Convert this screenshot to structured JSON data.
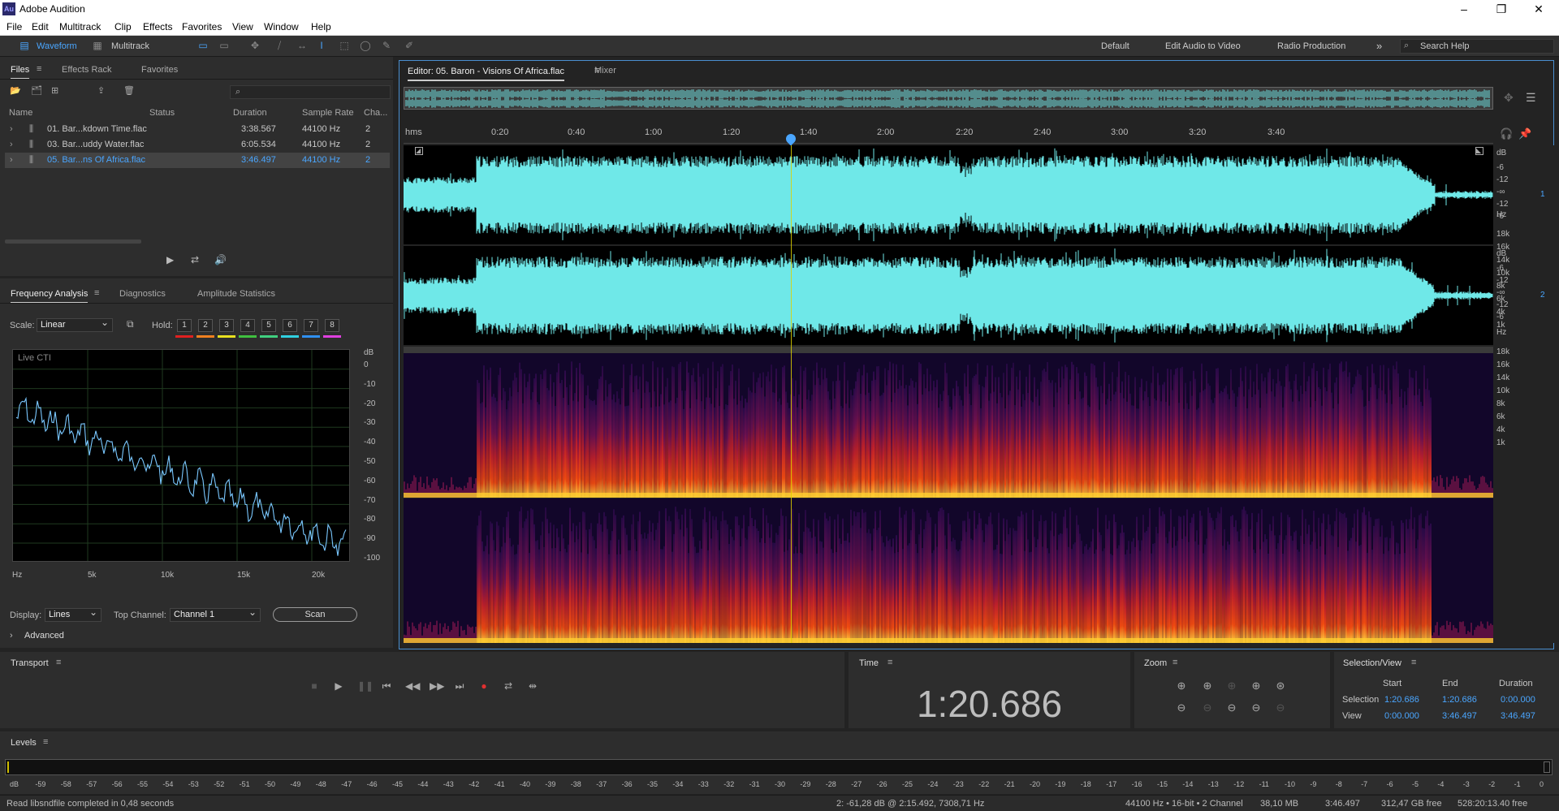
{
  "app": {
    "title": "Adobe Audition",
    "logo": "Au"
  },
  "menu": [
    "File",
    "Edit",
    "Multitrack",
    "Clip",
    "Effects",
    "Favorites",
    "View",
    "Window",
    "Help"
  ],
  "toolbar": {
    "waveform": "Waveform",
    "multitrack": "Multitrack",
    "workspaces": [
      "Default",
      "Edit Audio to Video",
      "Radio Production"
    ],
    "search_placeholder": "Search Help"
  },
  "files": {
    "tabs": [
      "Files",
      "Effects Rack",
      "Favorites"
    ],
    "columns": [
      "Name",
      "Status",
      "Duration",
      "Sample Rate",
      "Cha..."
    ],
    "rows": [
      {
        "name": "01. Bar...kdown Time.flac",
        "duration": "3:38.567",
        "rate": "44100 Hz",
        "ch": "2"
      },
      {
        "name": "03. Bar...uddy Water.flac",
        "duration": "6:05.534",
        "rate": "44100 Hz",
        "ch": "2"
      },
      {
        "name": "05. Bar...ns Of Africa.flac",
        "duration": "3:46.497",
        "rate": "44100 Hz",
        "ch": "2"
      }
    ]
  },
  "analysis": {
    "tabs": [
      "Frequency Analysis",
      "Diagnostics",
      "Amplitude Statistics"
    ],
    "scale_label": "Scale:",
    "scale_value": "Linear",
    "hold_label": "Hold:",
    "hold": [
      "1",
      "2",
      "3",
      "4",
      "5",
      "6",
      "7",
      "8"
    ],
    "hold_colors": [
      "#e02020",
      "#f08020",
      "#e8e020",
      "#40c040",
      "#40d080",
      "#30d0e0",
      "#3090f0",
      "#e040e0"
    ],
    "live": "Live CTI",
    "db_label": "dB",
    "db_ticks": [
      "0",
      "-10",
      "-20",
      "-30",
      "-40",
      "-50",
      "-60",
      "-70",
      "-80",
      "-90",
      "-100"
    ],
    "hz_ticks": [
      "Hz",
      "5k",
      "10k",
      "15k",
      "20k"
    ],
    "display_label": "Display:",
    "display_value": "Lines",
    "top_channel_label": "Top Channel:",
    "top_channel_value": "Channel 1",
    "scan": "Scan",
    "advanced": "Advanced"
  },
  "editor": {
    "tab": "Editor: 05. Baron - Visions Of Africa.flac",
    "mixer": "Mixer",
    "ruler": [
      "hms",
      "0:20",
      "0:40",
      "1:00",
      "1:20",
      "1:40",
      "2:00",
      "2:20",
      "2:40",
      "3:00",
      "3:20",
      "3:40"
    ],
    "db_ticks": [
      "dB",
      "-6",
      "-12",
      "-∞",
      "-12",
      "-6"
    ],
    "ch1": "1",
    "ch2": "2",
    "hz_ticks": [
      "Hz",
      "18k",
      "16k",
      "14k",
      "10k",
      "8k",
      "6k",
      "4k",
      "1k"
    ]
  },
  "transport": {
    "title": "Transport"
  },
  "time": {
    "title": "Time",
    "value": "1:20.686"
  },
  "zoom": {
    "title": "Zoom"
  },
  "selection": {
    "title": "Selection/View",
    "headers": [
      "Start",
      "End",
      "Duration"
    ],
    "rows": [
      {
        "label": "Selection",
        "start": "1:20.686",
        "end": "1:20.686",
        "dur": "0:00.000"
      },
      {
        "label": "View",
        "start": "0:00.000",
        "end": "3:46.497",
        "dur": "3:46.497"
      }
    ]
  },
  "levels": {
    "title": "Levels",
    "ticks": [
      "dB",
      "-59",
      "-58",
      "-57",
      "-56",
      "-55",
      "-54",
      "-53",
      "-52",
      "-51",
      "-50",
      "-49",
      "-48",
      "-47",
      "-46",
      "-45",
      "-44",
      "-43",
      "-42",
      "-41",
      "-40",
      "-39",
      "-38",
      "-37",
      "-36",
      "-35",
      "-34",
      "-33",
      "-32",
      "-31",
      "-30",
      "-29",
      "-28",
      "-27",
      "-26",
      "-25",
      "-24",
      "-23",
      "-22",
      "-21",
      "-20",
      "-19",
      "-18",
      "-17",
      "-16",
      "-15",
      "-14",
      "-13",
      "-12",
      "-11",
      "-10",
      "-9",
      "-8",
      "-7",
      "-6",
      "-5",
      "-4",
      "-3",
      "-2",
      "-1",
      "0"
    ]
  },
  "status": {
    "left": "Read libsndfile completed in 0,48 seconds",
    "cursor": "2: -61,28 dB @ 2:15.492, 7308,71 Hz",
    "format": "44100 Hz • 16-bit • 2 Channel",
    "size": "38,10 MB",
    "duration": "3:46.497",
    "free": "312,47 GB free",
    "free_time": "528:20:13.40 free"
  }
}
